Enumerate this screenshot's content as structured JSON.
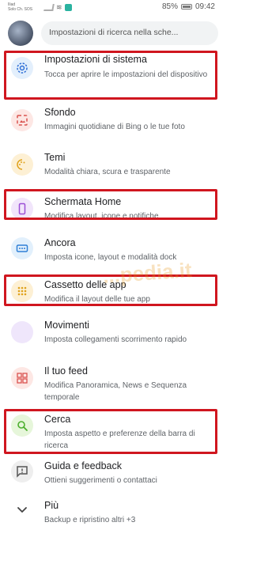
{
  "statusbar": {
    "carrier_line1": "Iliad",
    "carrier_line2": "Solo Ch. SOS",
    "battery": "85%",
    "time": "09:42"
  },
  "search": {
    "placeholder": "Impostazioni di ricerca nella sche..."
  },
  "items": [
    {
      "title": "Impostazioni di sistema",
      "subtitle": "Tocca per aprire le impostazioni del dispositivo",
      "icon": "gear-icon",
      "color": "#e3effc",
      "fg": "#2f6fd6"
    },
    {
      "title": "Sfondo",
      "subtitle": "Immagini quotidiane di Bing o le tue foto",
      "icon": "wallpaper-icon",
      "color": "#fde7e4",
      "fg": "#d9534f"
    },
    {
      "title": "Temi",
      "subtitle": "Modalità chiara, scura e trasparente",
      "icon": "palette-icon",
      "color": "#fdf0d4",
      "fg": "#e0a21c"
    },
    {
      "title": "Schermata Home",
      "subtitle": "Modifica layout, icone e notifiche",
      "icon": "phone-icon",
      "color": "#f1e5fb",
      "fg": "#9b4fd6"
    },
    {
      "title": "Ancora",
      "subtitle": "Imposta icone, layout e modalità dock",
      "icon": "dock-icon",
      "color": "#e2f0fc",
      "fg": "#2f7fd6"
    },
    {
      "title": "Cassetto delle app",
      "subtitle": "Modifica il layout delle tue app",
      "icon": "app-grid-icon",
      "color": "#fdf0d4",
      "fg": "#e0a21c"
    },
    {
      "title": "Movimenti",
      "subtitle": "Imposta collegamenti scorrimento rapido",
      "icon": "gesture-icon",
      "color": "#efe6fb",
      "fg": "#7b4fd6"
    },
    {
      "title": "Il tuo feed",
      "subtitle": "Modifica Panoramica, News e Sequenza temporale",
      "icon": "feed-icon",
      "color": "#fde7e4",
      "fg": "#d9534f"
    },
    {
      "title": "Cerca",
      "subtitle": "Imposta aspetto e preferenze della barra di ricerca",
      "icon": "search-icon",
      "color": "#e6f6da",
      "fg": "#4caf2e"
    },
    {
      "title": "Guida e feedback",
      "subtitle": "Ottieni suggerimenti o contattaci",
      "icon": "feedback-icon",
      "color": "#eeeeee",
      "fg": "#555555"
    },
    {
      "title": "Più",
      "subtitle": "Backup e ripristino altri +3",
      "icon": "chevron-down-icon",
      "color": "#ffffff",
      "fg": "#444444"
    }
  ],
  "highlight_color": "#d0161f",
  "watermark": "...pedia.it"
}
